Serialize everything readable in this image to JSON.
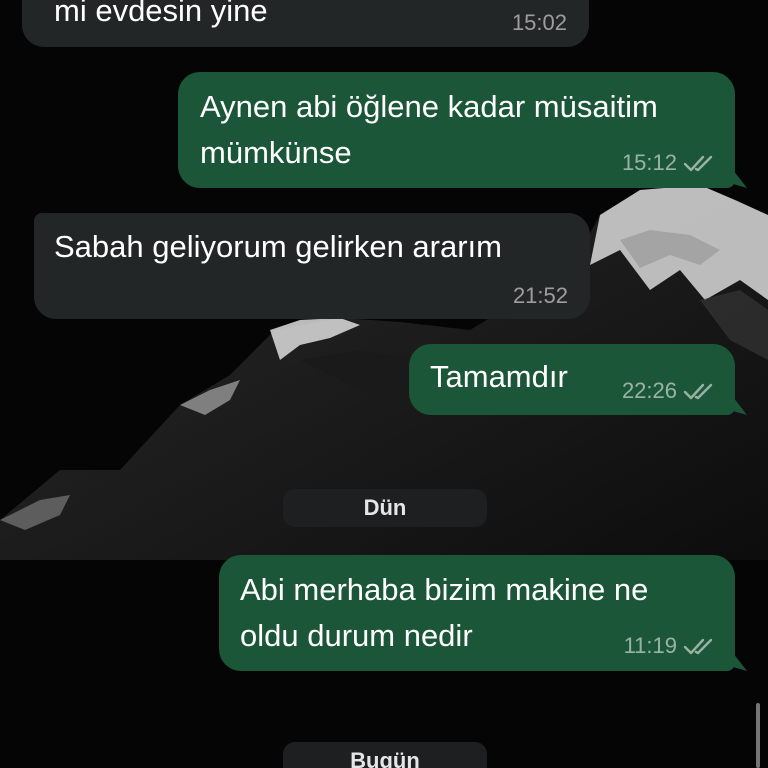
{
  "messages": [
    {
      "direction": "in",
      "text": "mi evdesin yine",
      "time": "15:02",
      "read": false
    },
    {
      "direction": "out",
      "text": "Aynen abi öğlene kadar müsaitim\nmümkünse",
      "time": "15:12",
      "read": true
    },
    {
      "direction": "in",
      "text": "Sabah geliyorum gelirken ararım",
      "time": "21:52",
      "read": false
    },
    {
      "direction": "out",
      "text": "Tamamdır",
      "time": "22:26",
      "read": true
    },
    {
      "direction": "out",
      "text": "Abi merhaba bizim makine ne\noldu durum nedir",
      "time": "11:19",
      "read": true
    }
  ],
  "date_separators": [
    "Dün",
    "Bugün"
  ],
  "colors": {
    "incoming_bubble": "#232627",
    "outgoing_bubble": "#1c5638",
    "background": "#050505"
  },
  "icons": {
    "read_receipt": "double-check-icon"
  }
}
